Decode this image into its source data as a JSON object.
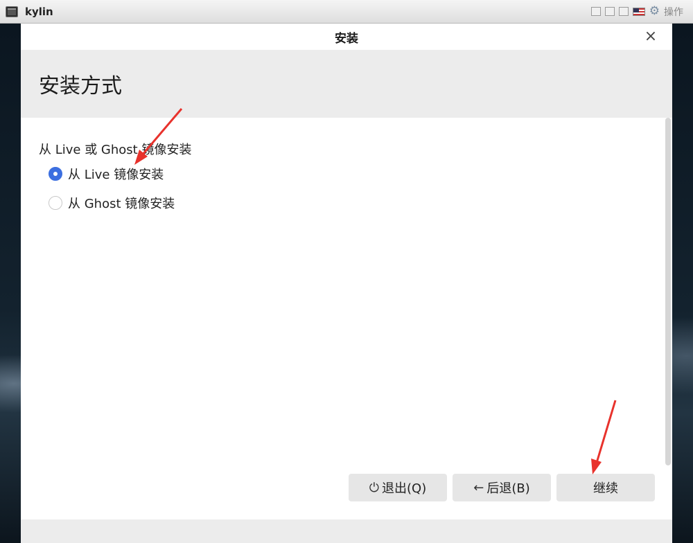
{
  "vm_bar": {
    "title": "kylin",
    "operate_label": "操作",
    "icons": [
      "monitor-icon",
      "restore-icon",
      "minimize-icon",
      "maximize-icon",
      "us-flag-icon",
      "gear-icon"
    ]
  },
  "window": {
    "title": "安装",
    "close_glyph": "×"
  },
  "page": {
    "heading": "安装方式",
    "group_label": "从 Live 或 Ghost 镜像安装",
    "options": [
      {
        "label": "从 Live 镜像安装",
        "selected": true
      },
      {
        "label": "从 Ghost 镜像安装",
        "selected": false
      }
    ]
  },
  "buttons": {
    "quit_label": "退出(Q)",
    "back_label": "后退(B)",
    "continue_label": "继续",
    "quit_icon": "⏻",
    "back_icon": "←"
  },
  "colors": {
    "accent": "#3c6fe0",
    "annotation": "#e8322c"
  }
}
